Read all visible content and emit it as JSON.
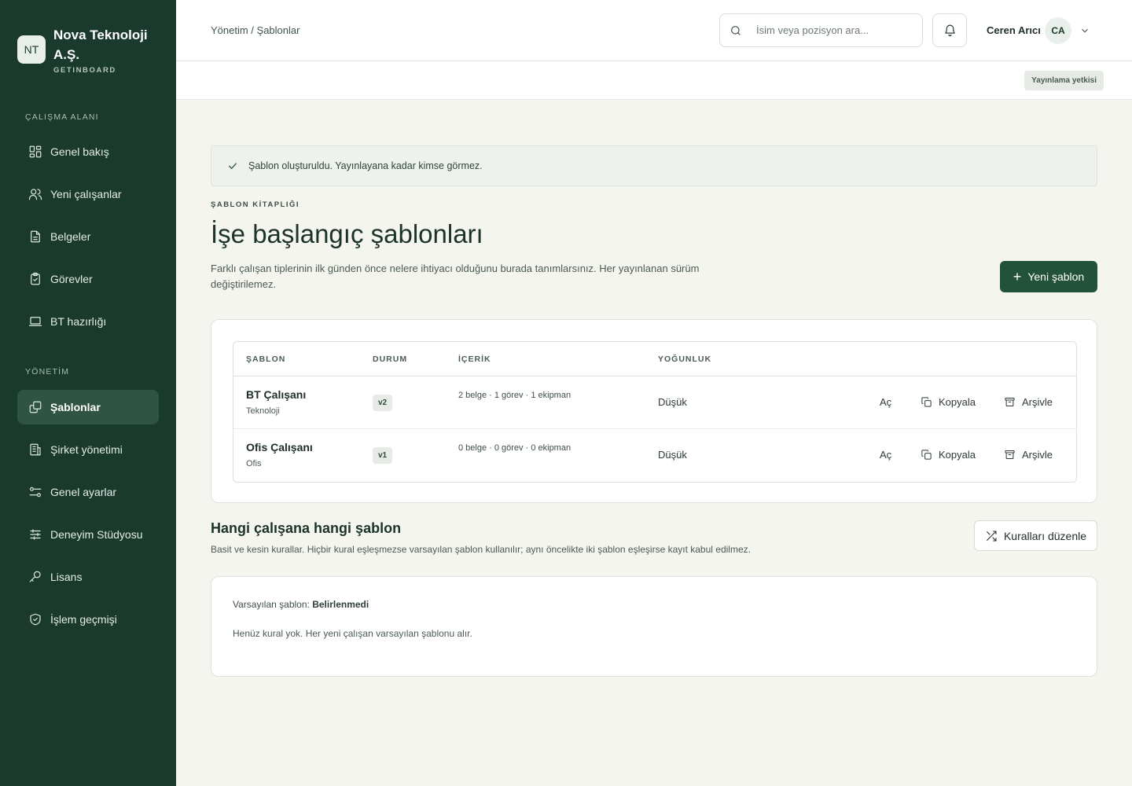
{
  "brand": {
    "logo": "NT",
    "name": "Nova Teknoloji A.Ş.",
    "sub": "GETINBOARD"
  },
  "sidebar": {
    "workspace_label": "ÇALIŞMA ALANI",
    "management_label": "YÖNETİM",
    "workspace_items": [
      {
        "label": "Genel bakış",
        "icon": "grid-icon"
      },
      {
        "label": "Yeni çalışanlar",
        "icon": "users-icon"
      },
      {
        "label": "Belgeler",
        "icon": "document-icon"
      },
      {
        "label": "Görevler",
        "icon": "clipboard-check-icon"
      },
      {
        "label": "BT hazırlığı",
        "icon": "laptop-icon"
      }
    ],
    "management_items": [
      {
        "label": "Şablonlar",
        "icon": "copy-icon",
        "active": true
      },
      {
        "label": "Şirket yönetimi",
        "icon": "building-icon"
      },
      {
        "label": "Genel ayarlar",
        "icon": "toggles-icon"
      },
      {
        "label": "Deneyim Stüdyosu",
        "icon": "sliders-icon"
      },
      {
        "label": "Lisans",
        "icon": "key-icon"
      },
      {
        "label": "İşlem geçmişi",
        "icon": "shield-check-icon"
      }
    ]
  },
  "header": {
    "breadcrumb": "Yönetim / Şablonlar",
    "search_placeholder": "İsim veya pozisyon ara...",
    "user_name": "Ceren Arıcı",
    "user_initials": "CA",
    "permission_badge": "Yayınlama yetkisi"
  },
  "toast": {
    "message": "Şablon oluşturuldu. Yayınlayana kadar kimse görmez."
  },
  "main": {
    "kicker": "ŞABLON KİTAPLIĞI",
    "title": "İşe başlangıç şablonları",
    "description": "Farklı çalışan tiplerinin ilk günden önce nelere ihtiyacı olduğunu burada tanımlarsınız. Her yayınlanan sürüm değiştirilemez.",
    "new_button": "Yeni şablon"
  },
  "table": {
    "headers": {
      "template": "ŞABLON",
      "status": "DURUM",
      "content": "İÇERİK",
      "load": "YOĞUNLUK"
    },
    "rows": [
      {
        "name": "BT Çalışanı",
        "category": "Teknoloji",
        "version": "v2",
        "content": "2 belge · 1 görev · 1 ekipman",
        "load": "Düşük",
        "open": "Aç",
        "copy": "Kopyala",
        "archive": "Arşivle"
      },
      {
        "name": "Ofis Çalışanı",
        "category": "Ofis",
        "version": "v1",
        "content": "0 belge · 0 görev · 0 ekipman",
        "load": "Düşük",
        "open": "Aç",
        "copy": "Kopyala",
        "archive": "Arşivle"
      }
    ]
  },
  "rules": {
    "title": "Hangi çalışana hangi şablon",
    "description": "Basit ve kesin kurallar. Hiçbir kural eşleşmezse varsayılan şablon kullanılır; aynı öncelikte iki şablon eşleşirse kayıt kabul edilmez.",
    "edit_button": "Kuralları düzenle",
    "default_label": "Varsayılan şablon:",
    "default_value": "Belirlenmedi",
    "empty_message": "Henüz kural yok. Her yeni çalışan varsayılan şablonu alır."
  },
  "colors": {
    "sidebar": "#1b3a2e",
    "accent": "#23523a",
    "background": "#f5f5f0"
  }
}
